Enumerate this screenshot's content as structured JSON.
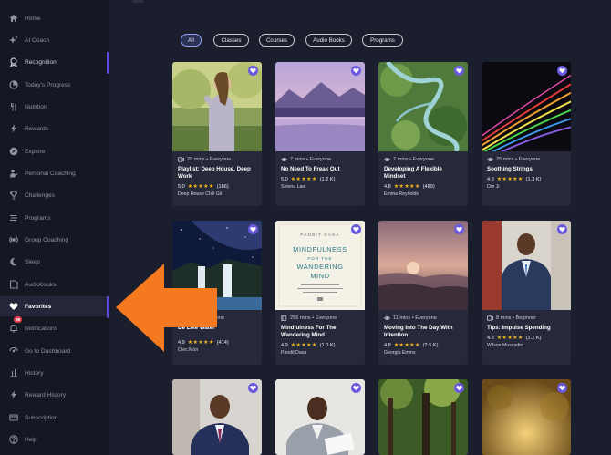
{
  "sidebar": {
    "items": [
      {
        "label": "Home",
        "icon": "home-icon"
      },
      {
        "label": "AI Coach",
        "icon": "sparkle-icon"
      },
      {
        "label": "Recognition",
        "icon": "recognition-icon"
      },
      {
        "label": "Today's Progress",
        "icon": "progress-icon"
      },
      {
        "label": "Nutrition",
        "icon": "nutrition-icon"
      },
      {
        "label": "Rewards",
        "icon": "lightning-icon"
      },
      {
        "label": "Explore",
        "icon": "compass-icon"
      },
      {
        "label": "Personal Coaching",
        "icon": "coach-icon"
      },
      {
        "label": "Challenges",
        "icon": "trophy-icon"
      },
      {
        "label": "Programs",
        "icon": "programs-icon"
      },
      {
        "label": "Group Coaching",
        "icon": "broadcast-icon"
      },
      {
        "label": "Sleep",
        "icon": "moon-icon"
      },
      {
        "label": "Audiobooks",
        "icon": "audiobook-icon"
      },
      {
        "label": "Favorites",
        "icon": "heart-icon"
      },
      {
        "label": "Notifications",
        "icon": "bell-icon",
        "badge": "98"
      },
      {
        "label": "Go to Dashboard",
        "icon": "dashboard-icon"
      },
      {
        "label": "History",
        "icon": "history-icon"
      },
      {
        "label": "Reward History",
        "icon": "lightning-icon"
      },
      {
        "label": "Subscription",
        "icon": "card-icon"
      },
      {
        "label": "Help",
        "icon": "help-icon"
      }
    ]
  },
  "filters": [
    "All",
    "Classes",
    "Courses",
    "Audio Books",
    "Programs"
  ],
  "cards": [
    {
      "meta": "20 mins • Everyone",
      "meta_icon": "video-icon",
      "title": "Playlist: Deep House, Deep Work",
      "rating": "5.0",
      "count": "(166)",
      "author": "Deep House Chill Girl"
    },
    {
      "meta": "7 mins • Everyone",
      "meta_icon": "eye-icon",
      "title": "No Need To Freak Out",
      "rating": "5.0",
      "count": "(1.2 K)",
      "author": "Selena Laei"
    },
    {
      "meta": "7 mins • Everyone",
      "meta_icon": "eye-icon",
      "title": "Developing A Flexible Mindset",
      "rating": "4.8",
      "count": "(489)",
      "author": "Emma Reynolds"
    },
    {
      "meta": "25 mins • Everyone",
      "meta_icon": "eye-icon",
      "title": "Soothing Strings",
      "rating": "4.8",
      "count": "(1.3 K)",
      "author": "Om Ji"
    },
    {
      "meta": "• Everyone",
      "meta_icon": "",
      "title": "Be Like Water",
      "rating": "4.9",
      "count": "(414)",
      "author": "Olec Mün"
    },
    {
      "meta": "256 mins • Everyone",
      "meta_icon": "book-icon",
      "title": "Mindfulness For The Wandering Mind",
      "rating": "4.9",
      "count": "(1.0 K)",
      "author": "Pandit Dasa"
    },
    {
      "meta": "11 mins • Everyone",
      "meta_icon": "eye-icon",
      "title": "Moving Into The Day With Intention",
      "rating": "4.8",
      "count": "(2.5 K)",
      "author": "Georgia Emms"
    },
    {
      "meta": "8 mins • Beginner",
      "meta_icon": "video-icon",
      "title": "Tips: Impulse Spending",
      "rating": "4.8",
      "count": "(1.2 K)",
      "author": "Wilson Muscadin"
    }
  ],
  "stars": "★★★★★",
  "book_cover": {
    "author": "PANDIT DASA",
    "title_line1": "MINDFULNESS",
    "title_line2": "FOR THE",
    "title_line3": "WANDERING",
    "title_line4": "MIND"
  },
  "colors": {
    "accent": "#6a5ae0",
    "active_indicator": "#5b4bd6",
    "arrow": "#f57a1f",
    "star": "#f5b81c",
    "badge": "#e33d4d"
  }
}
